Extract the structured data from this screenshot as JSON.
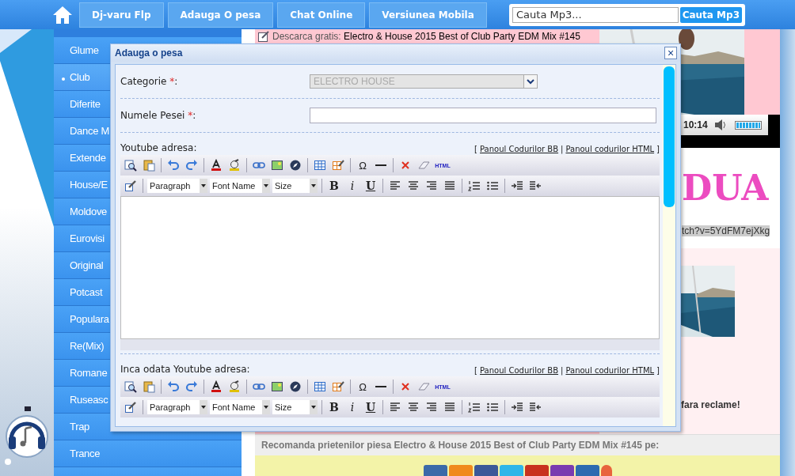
{
  "top_nav": {
    "items": [
      {
        "label": "Dj-varu Flp"
      },
      {
        "label": "Adauga O pesa"
      },
      {
        "label": "Chat Online"
      },
      {
        "label": "Versiunea Mobila"
      }
    ]
  },
  "search": {
    "placeholder": "Cauta Mp3...",
    "button": "Cauta Mp3"
  },
  "sidebar": {
    "items": [
      {
        "label": "Glume",
        "selected": false
      },
      {
        "label": "Club",
        "selected": true
      },
      {
        "label": "Diferite",
        "selected": false
      },
      {
        "label": "Dance M",
        "selected": false
      },
      {
        "label": "Extende",
        "selected": false
      },
      {
        "label": "House/E",
        "selected": false
      },
      {
        "label": "Moldove",
        "selected": false
      },
      {
        "label": "Eurovisi",
        "selected": false
      },
      {
        "label": "Original",
        "selected": false
      },
      {
        "label": "Potcast",
        "selected": false
      },
      {
        "label": "Populara",
        "selected": false
      },
      {
        "label": "Re(Mix)",
        "selected": false
      },
      {
        "label": "Romane",
        "selected": false
      },
      {
        "label": "Ruseasc",
        "selected": false
      },
      {
        "label": "Trap",
        "selected": false
      },
      {
        "label": "Trance",
        "selected": false
      }
    ]
  },
  "content": {
    "download_label": "Descarca gratis:",
    "download_title": "Electro & House 2015 Best of Club Party EDM Mix #145",
    "player": {
      "time": "10:14",
      "volume": {
        "level": 1
      }
    },
    "logo_text": "DUA",
    "url_fragment": "tch?v=5YdFM7ejXkg",
    "notice": "fara reclame!",
    "recommend": "Recomanda prietenilor piesa Electro & House 2015 Best of Club Party EDM Mix #145 pe:",
    "share_buttons": [
      {
        "color": "#3b6aa8"
      },
      {
        "color": "#f08a1c"
      },
      {
        "color": "#3b5998"
      },
      {
        "color": "#2fb6e8"
      },
      {
        "color": "#c8321e"
      },
      {
        "color": "#7a3bb0"
      },
      {
        "color": "#2d6bb0"
      },
      {
        "color": "#e8643c"
      }
    ]
  },
  "dialog": {
    "title": "Adauga o pesa",
    "close": "×",
    "fields": [
      {
        "kind": "select",
        "label": "Categorie",
        "required_mark": "*",
        "suffix": ":",
        "value": "ELECTRO HOUSE",
        "disabled": true
      },
      {
        "kind": "text",
        "label": "Numele Pesei",
        "required_mark": "*",
        "suffix": ":"
      },
      {
        "kind": "editor",
        "label": "Youtube adresa:",
        "links": {
          "open": "[",
          "items": [
            "Panoul Codurilor BB",
            "Panoul codurilor HTML"
          ],
          "separator": "|",
          "close": "]"
        },
        "selects": [
          "Paragraph",
          "Font Name",
          "Size"
        ],
        "special_char": "Ω",
        "html_label": "HTML",
        "format": [
          "B",
          "i",
          "U"
        ],
        "area": true
      },
      {
        "kind": "editor",
        "label": "Inca odata Youtube adresa:",
        "links": {
          "open": "[",
          "items": [
            "Panoul Codurilor BB",
            "Panoul codurilor HTML"
          ],
          "separator": "|",
          "close": "]"
        },
        "selects": [
          "Paragraph",
          "Font Name",
          "Size"
        ],
        "special_char": "Ω",
        "html_label": "HTML",
        "format": [
          "B",
          "i",
          "U"
        ],
        "area": false
      }
    ]
  }
}
